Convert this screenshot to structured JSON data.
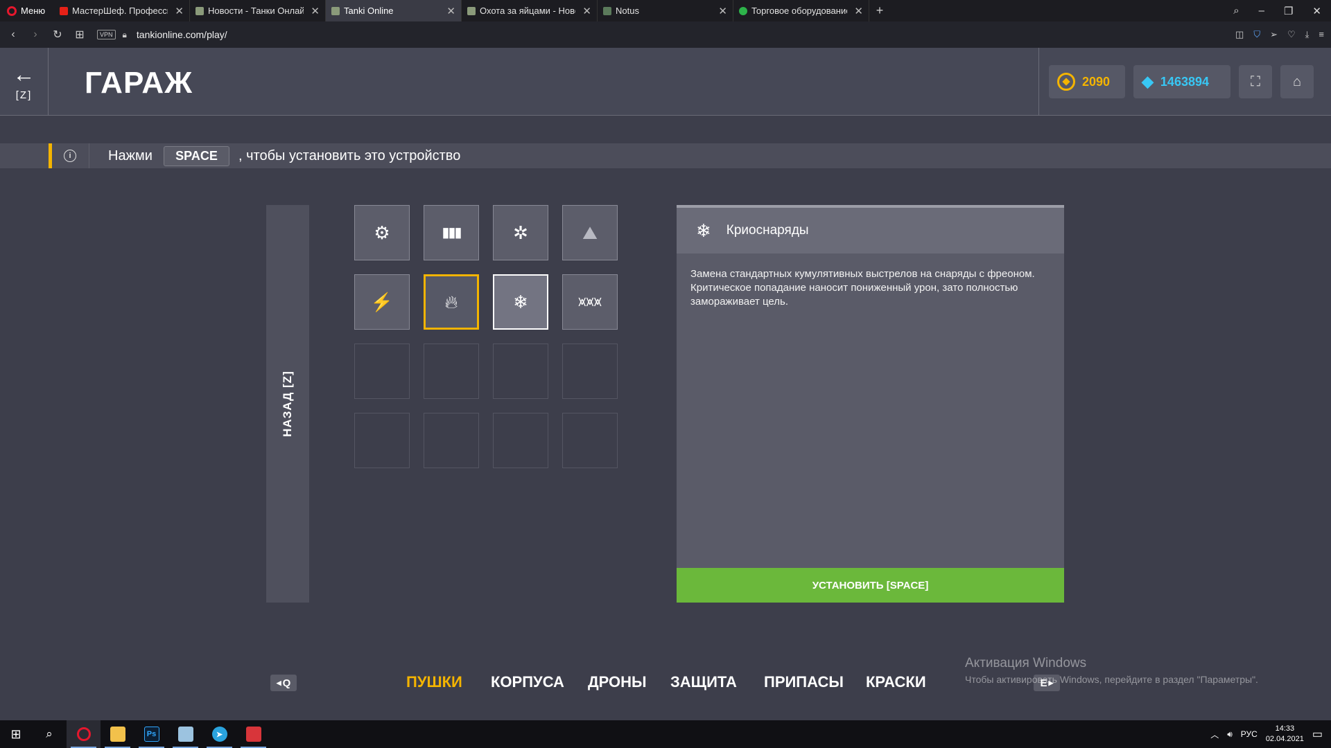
{
  "browser": {
    "menu_label": "Меню",
    "tabs": [
      {
        "title": "МастерШеф. Профессионалы",
        "icon": "youtube-icon",
        "active": false
      },
      {
        "title": "Новости - Танки Онлайн",
        "icon": "tank-icon",
        "active": false
      },
      {
        "title": "Tanki Online",
        "icon": "tank-icon",
        "active": true
      },
      {
        "title": "Охота за яйцами - Новости",
        "icon": "tank-icon",
        "active": false
      },
      {
        "title": "Notus",
        "icon": "notus-icon",
        "active": false
      },
      {
        "title": "Торговое оборудование",
        "icon": "green-icon",
        "active": false
      }
    ],
    "url": "tankionline.com/play/",
    "vpn_label": "VPN"
  },
  "header": {
    "back_key": "[Z]",
    "title": "ГАРАЖ",
    "gold": "2090",
    "crystals": "1463894"
  },
  "hint": {
    "prefix": "Нажми",
    "key": "SPACE",
    "suffix": ", чтобы установить это устройство"
  },
  "side_back_label": "НАЗАД [Z]",
  "grid": {
    "items": [
      {
        "name": "gear-icon",
        "state": "normal"
      },
      {
        "name": "ammo-icon",
        "state": "normal"
      },
      {
        "name": "shrapnel-icon",
        "state": "normal"
      },
      {
        "name": "tank-shell-icon",
        "state": "normal"
      },
      {
        "name": "electric-shell-icon",
        "state": "normal"
      },
      {
        "name": "incendiary-shell-icon",
        "state": "equipped"
      },
      {
        "name": "cryo-shell-icon",
        "state": "selected"
      },
      {
        "name": "rocket-battery-icon",
        "state": "normal"
      }
    ],
    "empty_slots": 8
  },
  "detail": {
    "title": "Криоснаряды",
    "description_lines": [
      "Замена стандартных кумулятивных выстрелов на снаряды с фреоном.",
      "Критическое попадание наносит пониженный урон, зато полностью",
      "замораживает цель."
    ],
    "install_label": "УСТАНОВИТЬ [SPACE]"
  },
  "categories": {
    "prev_key": "Q",
    "next_key": "E",
    "items": [
      {
        "label": "ПУШКИ",
        "active": true
      },
      {
        "label": "КОРПУСА",
        "active": false
      },
      {
        "label": "ДРОНЫ",
        "active": false
      },
      {
        "label": "ЗАЩИТА",
        "active": false
      },
      {
        "label": "ПРИПАСЫ",
        "active": false
      },
      {
        "label": "КРАСКИ",
        "active": false
      }
    ]
  },
  "watermark": {
    "title": "Активация Windows",
    "text": "Чтобы активировать Windows, перейдите в раздел \"Параметры\"."
  },
  "taskbar": {
    "lang": "РУС",
    "time": "14:33",
    "date": "02.04.2021"
  },
  "colors": {
    "accent": "#f4b400",
    "install": "#6bb83b",
    "crystal": "#38c7f4"
  }
}
